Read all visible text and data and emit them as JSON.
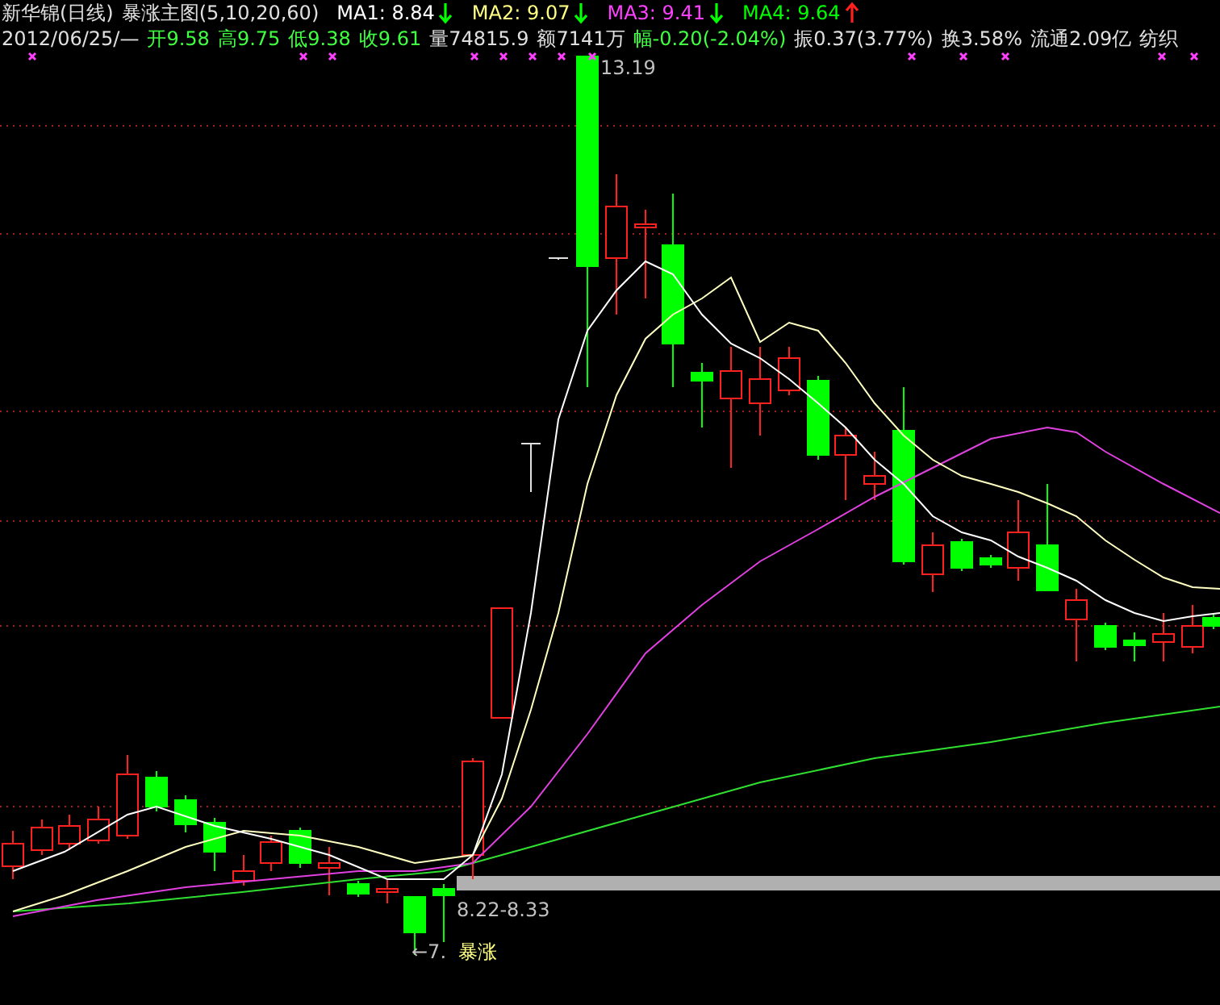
{
  "header": {
    "stock": "新华锦(日线)",
    "indicator": "暴涨主图(5,10,20,60)",
    "averages": [
      {
        "label": "MA1:",
        "value": "8.84",
        "kind": "falling",
        "color": "#ffffff"
      },
      {
        "label": "MA2:",
        "value": "9.07",
        "kind": "falling",
        "color": "#ffff80"
      },
      {
        "label": "MA3:",
        "value": "9.41",
        "kind": "falling",
        "color": "#ff40ff"
      },
      {
        "label": "MA4:",
        "value": "9.64",
        "kind": "rising",
        "color": "#00ff00"
      }
    ]
  },
  "quote": {
    "date": "2012/06/25/—",
    "fields": [
      {
        "label": "开",
        "value": "9.58",
        "color": "#40ff40"
      },
      {
        "label": "高",
        "value": "9.75",
        "color": "#40ff40"
      },
      {
        "label": "低",
        "value": "9.38",
        "color": "#40ff40"
      },
      {
        "label": "收",
        "value": "9.61",
        "color": "#40ff40"
      },
      {
        "label": "量",
        "value": "74815.9",
        "color": "#e0e0e0"
      },
      {
        "label": "额",
        "value": "7141万",
        "color": "#e0e0e0"
      },
      {
        "label": "幅",
        "value": "-0.20(-2.04%)",
        "color": "#40ff40"
      },
      {
        "label": "振",
        "value": "0.37(3.77%)",
        "color": "#e0e0e0"
      },
      {
        "label": "换",
        "value": "3.58%",
        "color": "#e0e0e0"
      },
      {
        "label": "流通",
        "value": "2.09亿",
        "color": "#e0e0e0"
      }
    ],
    "sector": "纺织"
  },
  "chart": {
    "annotations": [
      {
        "kind": "high",
        "text": "13.19"
      },
      {
        "kind": "range",
        "text": "8.22-8.33"
      },
      {
        "kind": "low",
        "text": "←7."
      },
      {
        "kind": "signal",
        "text": "暴涨"
      }
    ]
  }
}
